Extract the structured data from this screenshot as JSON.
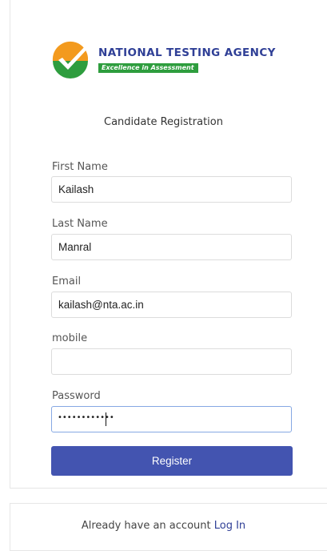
{
  "brand": {
    "name": "NATIONAL TESTING AGENCY",
    "tagline": "Excellence in Assessment",
    "colors": {
      "primary": "#2f3f96",
      "green": "#2e9d3e",
      "orange": "#f39a1e"
    }
  },
  "form": {
    "title": "Candidate Registration",
    "fields": {
      "first_name": {
        "label": "First Name",
        "value": "Kailash"
      },
      "last_name": {
        "label": "Last Name",
        "value": "Manral"
      },
      "email": {
        "label": "Email",
        "value": "kailash@nta.ac.in"
      },
      "mobile": {
        "label": "mobile",
        "value": ""
      },
      "password": {
        "label": "Password",
        "masked_value": "••••••••••••"
      }
    },
    "register_label": "Register"
  },
  "footer": {
    "prompt": "Already have an account",
    "login_label": "Log In"
  }
}
